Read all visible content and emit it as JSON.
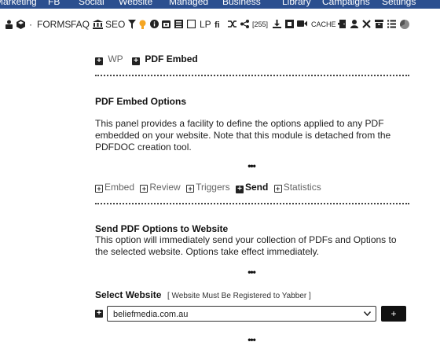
{
  "topnav": {
    "items": [
      "Marketing",
      "FB",
      "Social",
      "Website",
      "Managed",
      "Business",
      "Library",
      "Campaigns",
      "Settings"
    ]
  },
  "toolbar": {
    "bullet": "·",
    "forms": "FORMS",
    "faq": "FAQ",
    "seo": "SEO",
    "lp": "LP",
    "count": "[255]",
    "cache": "CACHE",
    "icons": [
      "user-lock-icon",
      "cube-icon",
      "bank-icon",
      "filter-icon",
      "lightbulb-icon",
      "info-icon",
      "calendar-icon",
      "list-icon",
      "square-icon",
      "fi-ligature-icon",
      "shuffle-icon",
      "share-icon",
      "download-icon",
      "box-icon",
      "video-icon",
      "door-icon",
      "user-icon",
      "tools-icon",
      "archive-icon",
      "bullets-icon",
      "pie-chart-icon"
    ]
  },
  "breadcrumb": {
    "wp": "WP",
    "current": "PDF Embed"
  },
  "options": {
    "heading": "PDF Embed Options",
    "body": "This panel provides a facility to define the options applied to any PDF embedded on your website. Note that this module is detached from the PDFDOC creation tool."
  },
  "ellipsis": "•••",
  "tabs": [
    {
      "label": "Embed",
      "active": false
    },
    {
      "label": "Review",
      "active": false
    },
    {
      "label": "Triggers",
      "active": false
    },
    {
      "label": "Send",
      "active": true
    },
    {
      "label": "Statistics",
      "active": false
    }
  ],
  "send": {
    "heading": "Send PDF Options to Website",
    "body": "This option will immediately send your collection of PDFs and Options to the selected website. Options take effect immediately."
  },
  "select": {
    "label": "Select Website",
    "note": "[ Website Must Be Registered to Yabber ]",
    "value": "beliefmedia.com.au",
    "add_label": "+"
  },
  "colors": {
    "nav_bg": "#2b4f8f",
    "accent": "#f5a623"
  }
}
